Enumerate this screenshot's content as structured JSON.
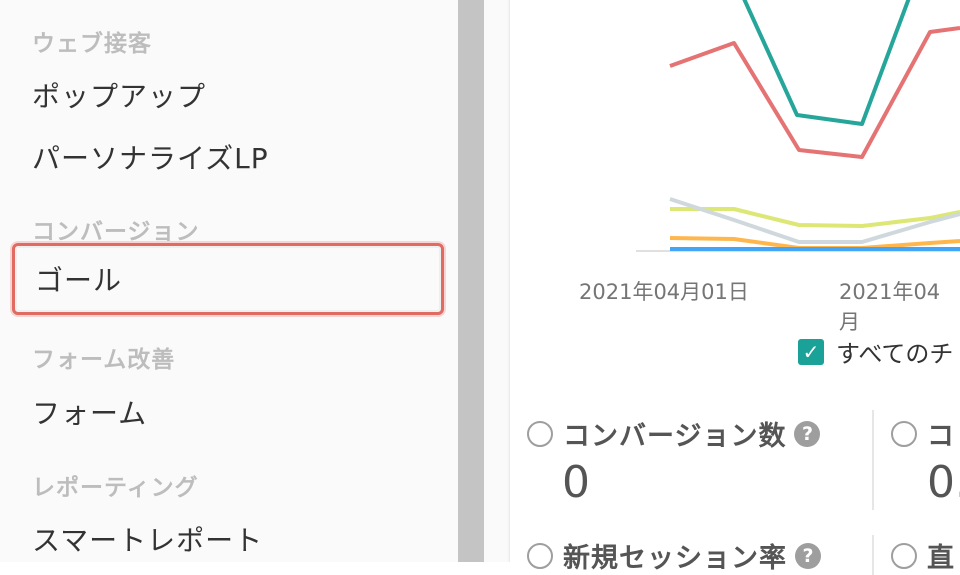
{
  "sidebar": {
    "sections": [
      {
        "heading": "ウェブ接客",
        "items": [
          "ポップアップ",
          "パーソナライズLP"
        ]
      },
      {
        "heading": "コンバージョン",
        "items": [
          "ゴール"
        ]
      },
      {
        "heading": "フォーム改善",
        "items": [
          "フォーム"
        ]
      },
      {
        "heading": "レポーティング",
        "items": [
          "スマートレポート"
        ]
      }
    ],
    "active_item": "ゴール"
  },
  "chart": {
    "x_ticks": [
      "2021年04月01日",
      "2021年04月"
    ],
    "show_all_label": "すべてのチ",
    "show_all_checked": true
  },
  "chart_data": {
    "type": "line",
    "series": [
      {
        "color": "#26a69a",
        "points": [
          [
            740,
            -10
          ],
          [
            797,
            115
          ],
          [
            862,
            124
          ],
          [
            912,
            -10
          ]
        ]
      },
      {
        "color": "#e57373",
        "points": [
          [
            670,
            66
          ],
          [
            734,
            43
          ],
          [
            799,
            150
          ],
          [
            862,
            157
          ],
          [
            930,
            32
          ],
          [
            960,
            28
          ]
        ]
      },
      {
        "color": "#dce775",
        "points": [
          [
            670,
            209
          ],
          [
            734,
            209
          ],
          [
            799,
            225
          ],
          [
            862,
            226
          ],
          [
            930,
            218
          ],
          [
            960,
            212
          ]
        ]
      },
      {
        "color": "#cfd8dc",
        "points": [
          [
            670,
            199
          ],
          [
            734,
            220
          ],
          [
            799,
            242
          ],
          [
            862,
            242
          ],
          [
            930,
            222
          ],
          [
            960,
            214
          ]
        ]
      },
      {
        "color": "#ffb74d",
        "points": [
          [
            670,
            238
          ],
          [
            734,
            239
          ],
          [
            799,
            248
          ],
          [
            862,
            248
          ],
          [
            930,
            243
          ],
          [
            960,
            241
          ]
        ]
      },
      {
        "color": "#42a5f5",
        "points": [
          [
            670,
            249
          ],
          [
            960,
            249
          ]
        ]
      }
    ]
  },
  "metrics": {
    "conversions": {
      "label": "コンバージョン数",
      "value": "0",
      "help": "?"
    },
    "right_top": {
      "label": "コ",
      "value": "0."
    },
    "new_session": {
      "label": "新規セッション率",
      "help": "?"
    },
    "right_bottom": {
      "label": "直"
    }
  }
}
